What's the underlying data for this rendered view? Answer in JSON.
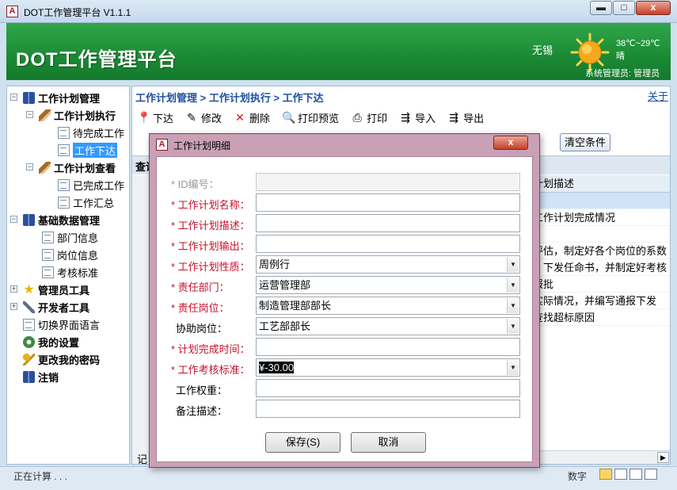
{
  "window": {
    "title": "DOT工作管理平台 V1.1.1",
    "app_icon_letter": "A",
    "min": "▬",
    "max": "□",
    "close": "x"
  },
  "banner": {
    "title": "DOT工作管理平台",
    "city": "无锡",
    "temperature": "38℃~29℃",
    "weather": "晴",
    "system_user": "系统管理员: 管理员",
    "weather_icon": "sun-icon"
  },
  "sidebar": {
    "items": [
      {
        "label": "工作计划管理",
        "icon": "book-icon"
      },
      {
        "label": "工作计划执行",
        "icon": "pen-icon"
      },
      {
        "label": "待完成工作",
        "icon": "doc-icon"
      },
      {
        "label": "工作下达",
        "icon": "doc-icon"
      },
      {
        "label": "工作计划查看",
        "icon": "pen-icon"
      },
      {
        "label": "已完成工作",
        "icon": "doc-icon"
      },
      {
        "label": "工作汇总",
        "icon": "doc-icon"
      },
      {
        "label": "基础数据管理",
        "icon": "book-icon"
      },
      {
        "label": "部门信息",
        "icon": "doc-icon"
      },
      {
        "label": "岗位信息",
        "icon": "doc-icon"
      },
      {
        "label": "考核标准",
        "icon": "doc-icon"
      },
      {
        "label": "管理员工具",
        "icon": "star-icon"
      },
      {
        "label": "开发者工具",
        "icon": "tool-icon"
      },
      {
        "label": "切换界面语言",
        "icon": "doc-icon"
      },
      {
        "label": "我的设置",
        "icon": "gear-icon"
      },
      {
        "label": "更改我的密码",
        "icon": "key-icon"
      },
      {
        "label": "注销",
        "icon": "book-icon"
      }
    ]
  },
  "main": {
    "breadcrumb": "工作计划管理 > 工作计划执行 > 工作下达",
    "about_link": "关于",
    "toolbar": [
      {
        "label": "下达",
        "icon": "issue-icon"
      },
      {
        "label": "修改",
        "icon": "edit-icon"
      },
      {
        "label": "删除",
        "icon": "delete-icon"
      },
      {
        "label": "打印预览",
        "icon": "print-preview-icon"
      },
      {
        "label": "打印",
        "icon": "print-icon"
      },
      {
        "label": "导入",
        "icon": "import-icon"
      },
      {
        "label": "导出",
        "icon": "export-icon"
      }
    ],
    "clear_button": "清空条件",
    "grid_strip_label": "查询",
    "grid_header": "计划描述",
    "grid_rows": [
      "",
      "工作计划完成情况",
      "",
      "评估，制定好各个岗位的系数",
      "，下发任命书，并制定好考核",
      "报批",
      "实际情况，并编写通报下发",
      "查找超标原因"
    ],
    "footer_label": "记"
  },
  "dialog": {
    "title": "工作计划明细",
    "icon_letter": "A",
    "close": "x",
    "fields": [
      {
        "label": "* ID编号：",
        "value": "",
        "type": "disabled"
      },
      {
        "label": "* 工作计划名称：",
        "value": "",
        "type": "text"
      },
      {
        "label": "* 工作计划描述：",
        "value": "",
        "type": "text"
      },
      {
        "label": "* 工作计划输出：",
        "value": "",
        "type": "text"
      },
      {
        "label": "* 工作计划性质：",
        "value": "周例行",
        "type": "select"
      },
      {
        "label": "* 责任部门：",
        "value": "运营管理部",
        "type": "select"
      },
      {
        "label": "* 责任岗位：",
        "value": "制造管理部部长",
        "type": "select"
      },
      {
        "label": "协助岗位：",
        "value": "工艺部部长",
        "type": "select"
      },
      {
        "label": "* 计划完成时间：",
        "value": "",
        "type": "text"
      },
      {
        "label": "* 工作考核标准：",
        "value": "¥-30.00",
        "type": "select-highlight"
      },
      {
        "label": "工作权重：",
        "value": "",
        "type": "text"
      },
      {
        "label": "备注描述：",
        "value": "",
        "type": "text"
      }
    ],
    "save_button": "保存(S)",
    "cancel_button": "取消"
  },
  "statusbar": {
    "status": "正在计算 . . .",
    "mode": "数字"
  }
}
